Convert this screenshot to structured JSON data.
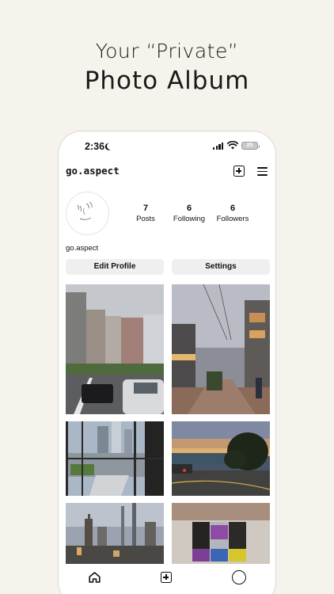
{
  "marketing": {
    "line1": "Your “Private”",
    "line2": "Photo Album"
  },
  "status_bar": {
    "time": "2:36",
    "battery": "25"
  },
  "header": {
    "username": "go.aspect",
    "icons": [
      "plus-square-icon",
      "menu-icon"
    ]
  },
  "profile": {
    "name": "go.aspect",
    "stats": [
      {
        "value": "7",
        "label": "Posts"
      },
      {
        "value": "6",
        "label": "Following"
      },
      {
        "value": "6",
        "label": "Followers"
      }
    ],
    "buttons": {
      "edit": "Edit Profile",
      "settings": "Settings"
    }
  },
  "grid": {
    "photos": [
      {
        "subject": "city-street-buildings"
      },
      {
        "subject": "dusk-shopping-street"
      },
      {
        "subject": "office-window-skyline"
      },
      {
        "subject": "sunset-road-trees"
      },
      {
        "subject": "skyscraper-skyline"
      },
      {
        "subject": "poster-wall"
      }
    ]
  },
  "tab_bar": {
    "icons": [
      "home-icon",
      "add-post-icon",
      "profile-icon"
    ]
  },
  "colors": {
    "background": "#f6f3ec",
    "button": "#efefef",
    "text": "#111111"
  }
}
